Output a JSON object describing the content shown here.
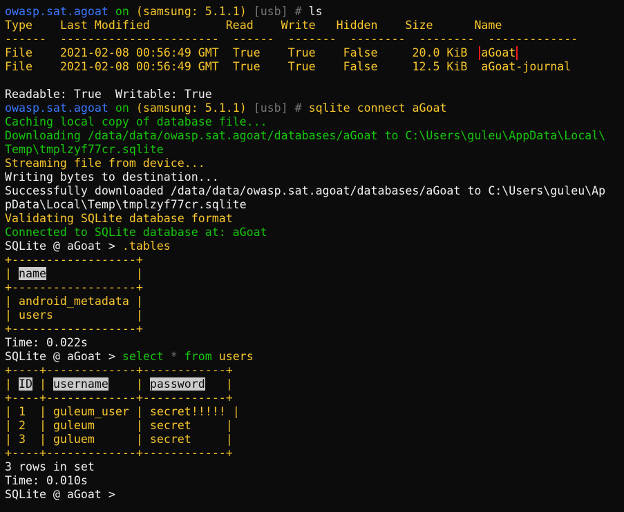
{
  "prompt": {
    "host": "owasp.sat.agoat",
    "on": "on",
    "device": "(samsung: 5.1.1)",
    "conn": "[usb]",
    "hash": "#"
  },
  "commands": {
    "ls": "ls",
    "sqlite_connect": "sqlite connect aGoat"
  },
  "ls_table": {
    "headers": [
      "Type",
      "Last Modified",
      "Read",
      "Write",
      "Hidden",
      "Size",
      "Name"
    ],
    "dashes": [
      "------",
      "-----------------------",
      "------",
      "-------",
      "--------",
      "--------",
      "-------------"
    ],
    "rows": [
      [
        "File",
        "2021-02-08 00:56:49 GMT",
        "True",
        "True",
        "False",
        "20.0 KiB",
        "aGoat"
      ],
      [
        "File",
        "2021-02-08 00:56:49 GMT",
        "True",
        "True",
        "False",
        "12.5 KiB",
        "aGoat-journal"
      ]
    ]
  },
  "perm_line": "Readable: True  Writable: True",
  "connect_output": {
    "caching": "Caching local copy of database file...",
    "downloading_1": "Downloading /data/data/owasp.sat.agoat/databases/aGoat to C:\\Users\\guleu\\AppData\\Local\\",
    "downloading_2": "Temp\\tmplzyf77cr.sqlite",
    "streaming": "Streaming file from device...",
    "writing": "Writing bytes to destination...",
    "success_1": "Successfully downloaded /data/data/owasp.sat.agoat/databases/aGoat to C:\\Users\\guleu\\Ap",
    "success_2": "pData\\Local\\Temp\\tmplzyf77cr.sqlite",
    "validating": "Validating SQLite database format",
    "connected": "Connected to SQLite database at: aGoat"
  },
  "sqlite_prompt": "SQLite @ aGoat > ",
  "tables_cmd": ".tables",
  "tables_result": {
    "border": "+------------------+",
    "header": "name",
    "rows": [
      "android_metadata",
      "users"
    ]
  },
  "time_1": "Time: 0.022s",
  "select_cmd": {
    "select": "select",
    "star": "*",
    "from": "from",
    "table": "users"
  },
  "users_result": {
    "border": "+----+-------------+------------+",
    "headers": [
      "ID",
      "username",
      "password"
    ],
    "rows": [
      [
        "1",
        "guleum_user",
        "secret!!!!!"
      ],
      [
        "2",
        "guleum",
        "secret"
      ],
      [
        "3",
        "guluem",
        "secret"
      ]
    ]
  },
  "rows_in_set": "3 rows in set",
  "time_2": "Time: 0.010s",
  "colors": {
    "background": "#0c0c0c",
    "prompt_host": "#3b78ff",
    "success_green": "#16c60c",
    "info_yellow": "#f9c72b",
    "highlight_box": "#ff1a1a"
  }
}
